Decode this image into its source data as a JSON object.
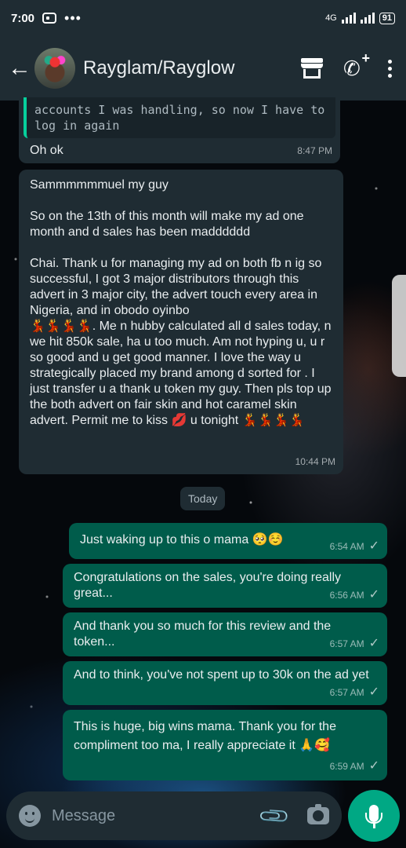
{
  "status_bar": {
    "time": "7:00",
    "dots": "•••",
    "network": "4G",
    "battery": "91"
  },
  "header": {
    "contact_name": "Rayglam/Rayglow",
    "icons": [
      "back-arrow-icon",
      "store-icon",
      "add-call-icon",
      "more-vert-icon"
    ]
  },
  "messages": [
    {
      "direction": "in",
      "quote": "accounts I was handling, so now I have to log in again",
      "text": "Oh ok",
      "time": "8:47 PM"
    },
    {
      "direction": "in",
      "text_parts": [
        "Sammmmmmuel my guy",
        "",
        "So on the 13th of this month will make my ad one month and d sales has been madddddd",
        "",
        "Chai. Thank u for managing my ad on both fb n ig so successful, I got 3 major distributors through this advert in 3 major city, the advert touch every area in Nigeria, and in obodo oyinbo",
        "💃💃💃💃. Me n hubby calculated all d sales today, n we hit 850k sale, ha u too much. Am not hyping u, u r so good and u get good manner. I love the way u strategically placed my brand among d sorted for . I just transfer u a thank u token my guy. Then pls top up the both advert on fair skin and hot caramel skin advert. Permit me to kiss 💋 u tonight 💃💃💃💃"
      ],
      "time": "10:44 PM"
    },
    {
      "direction": "out",
      "text": "Just waking up to this o mama 🥺☺️",
      "time": "6:54 AM"
    },
    {
      "direction": "out",
      "text": "Congratulations on the sales, you're doing really great...",
      "time": "6:56 AM"
    },
    {
      "direction": "out",
      "text": "And thank you so much for this review and the token...",
      "time": "6:57 AM"
    },
    {
      "direction": "out",
      "text": "And to think, you've not spent up to 30k on the ad yet",
      "time": "6:57 AM"
    },
    {
      "direction": "out",
      "text": "This is huge, big wins mama. Thank you for the compliment too ma, I really appreciate it 🙏🥰",
      "time": "6:59 AM"
    }
  ],
  "date_chip": "Today",
  "input": {
    "placeholder": "Message"
  },
  "colors": {
    "header_bg": "#1f2c33",
    "incoming_bubble": "#1f2c33",
    "outgoing_bubble": "#005c4b",
    "accent": "#00a884"
  }
}
